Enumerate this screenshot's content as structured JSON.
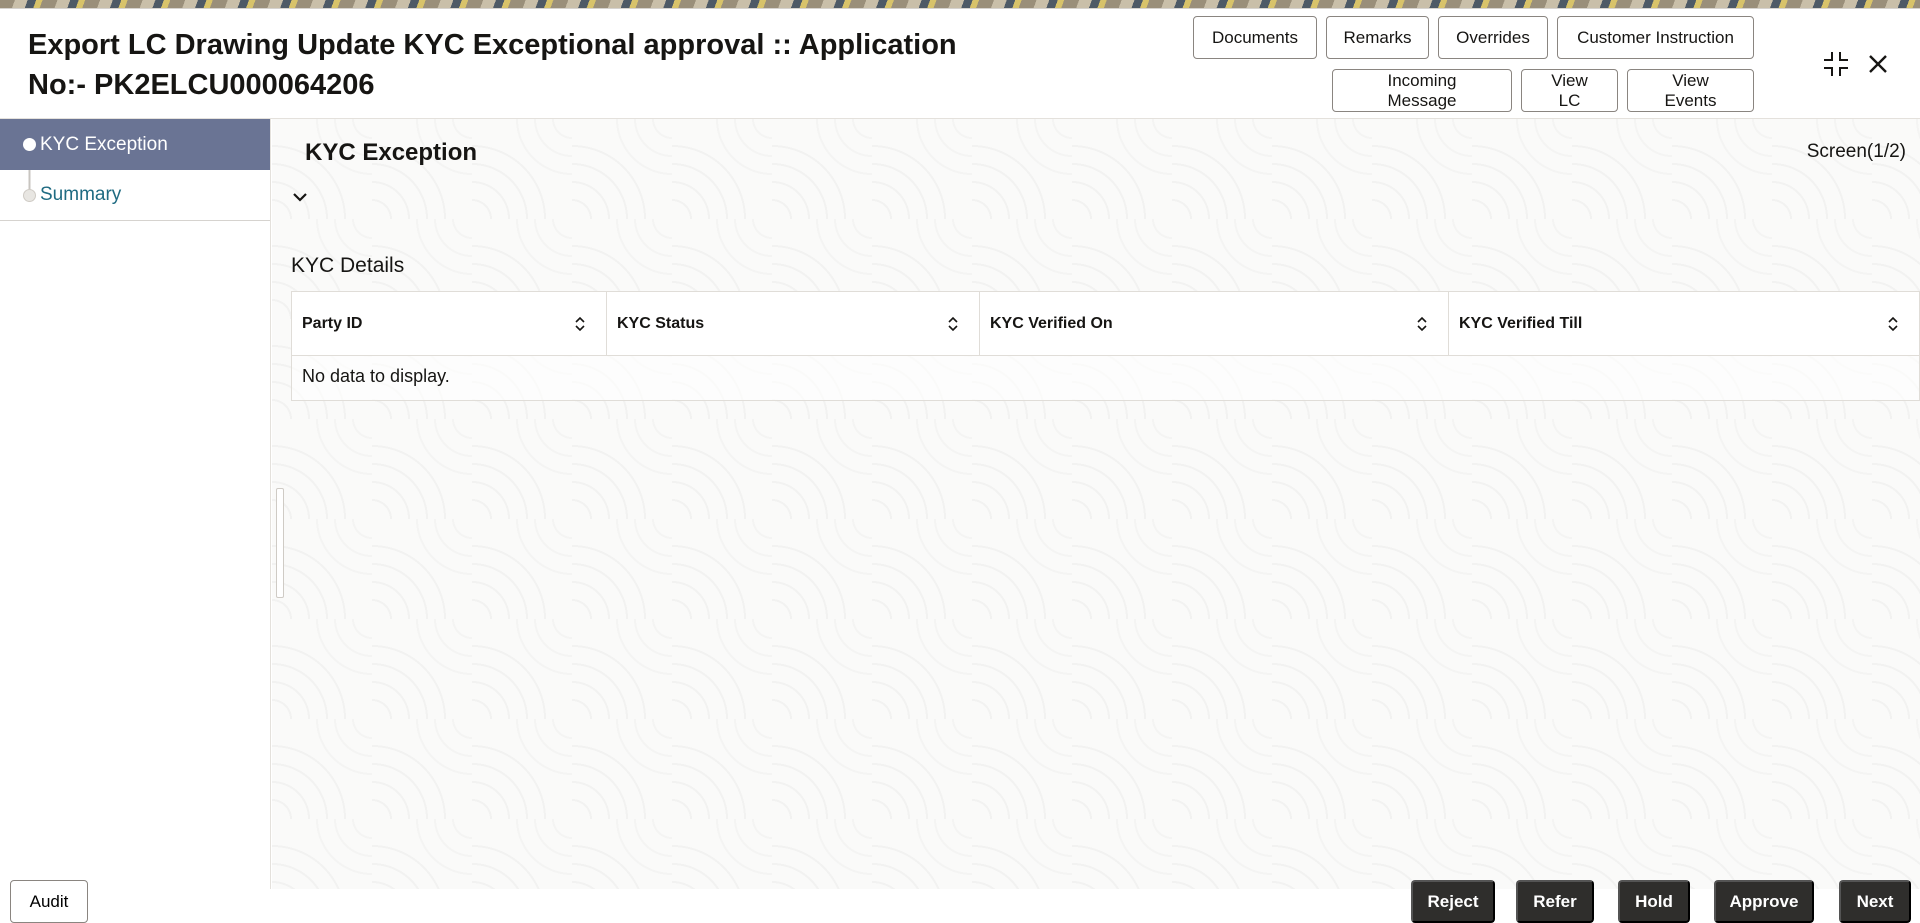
{
  "header": {
    "title_line1": "Export LC Drawing Update KYC Exceptional approval :: Application",
    "title_line2": "No:- PK2ELCU000064206",
    "buttons": {
      "documents": "Documents",
      "remarks": "Remarks",
      "overrides": "Overrides",
      "customer_instruction": "Customer Instruction",
      "incoming_message": "Incoming Message",
      "view_lc": "View LC",
      "view_events": "View Events"
    },
    "icons": {
      "collapse": "collapse-icon",
      "close": "close-icon"
    }
  },
  "sidebar": {
    "items": [
      {
        "label": "KYC Exception",
        "active": true
      },
      {
        "label": "Summary",
        "active": false
      }
    ]
  },
  "main": {
    "section_title": "KYC Exception",
    "screen_indicator": "Screen(1/2)",
    "kyc_details": {
      "title": "KYC Details",
      "columns": [
        "Party ID",
        "KYC Status",
        "KYC Verified On",
        "KYC Verified Till"
      ],
      "empty_message": "No data to display."
    }
  },
  "footer": {
    "audit": "Audit",
    "reject": "Reject",
    "refer": "Refer",
    "hold": "Hold",
    "approve": "Approve",
    "next": "Next"
  },
  "colors": {
    "sidebar_active_bg": "#6a7494",
    "sidebar_link": "#1f6b82",
    "footer_button_bg": "#2f2e2c"
  }
}
